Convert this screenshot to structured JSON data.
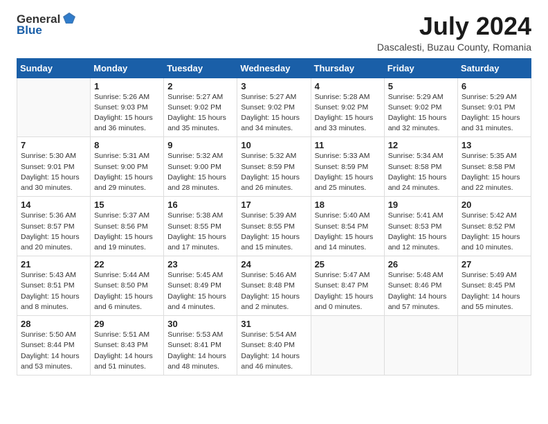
{
  "logo": {
    "general": "General",
    "blue": "Blue"
  },
  "title": "July 2024",
  "subtitle": "Dascalesti, Buzau County, Romania",
  "weekdays": [
    "Sunday",
    "Monday",
    "Tuesday",
    "Wednesday",
    "Thursday",
    "Friday",
    "Saturday"
  ],
  "weeks": [
    [
      {
        "day": "",
        "sunrise": "",
        "sunset": "",
        "daylight": ""
      },
      {
        "day": "1",
        "sunrise": "Sunrise: 5:26 AM",
        "sunset": "Sunset: 9:03 PM",
        "daylight": "Daylight: 15 hours and 36 minutes."
      },
      {
        "day": "2",
        "sunrise": "Sunrise: 5:27 AM",
        "sunset": "Sunset: 9:02 PM",
        "daylight": "Daylight: 15 hours and 35 minutes."
      },
      {
        "day": "3",
        "sunrise": "Sunrise: 5:27 AM",
        "sunset": "Sunset: 9:02 PM",
        "daylight": "Daylight: 15 hours and 34 minutes."
      },
      {
        "day": "4",
        "sunrise": "Sunrise: 5:28 AM",
        "sunset": "Sunset: 9:02 PM",
        "daylight": "Daylight: 15 hours and 33 minutes."
      },
      {
        "day": "5",
        "sunrise": "Sunrise: 5:29 AM",
        "sunset": "Sunset: 9:02 PM",
        "daylight": "Daylight: 15 hours and 32 minutes."
      },
      {
        "day": "6",
        "sunrise": "Sunrise: 5:29 AM",
        "sunset": "Sunset: 9:01 PM",
        "daylight": "Daylight: 15 hours and 31 minutes."
      }
    ],
    [
      {
        "day": "7",
        "sunrise": "Sunrise: 5:30 AM",
        "sunset": "Sunset: 9:01 PM",
        "daylight": "Daylight: 15 hours and 30 minutes."
      },
      {
        "day": "8",
        "sunrise": "Sunrise: 5:31 AM",
        "sunset": "Sunset: 9:00 PM",
        "daylight": "Daylight: 15 hours and 29 minutes."
      },
      {
        "day": "9",
        "sunrise": "Sunrise: 5:32 AM",
        "sunset": "Sunset: 9:00 PM",
        "daylight": "Daylight: 15 hours and 28 minutes."
      },
      {
        "day": "10",
        "sunrise": "Sunrise: 5:32 AM",
        "sunset": "Sunset: 8:59 PM",
        "daylight": "Daylight: 15 hours and 26 minutes."
      },
      {
        "day": "11",
        "sunrise": "Sunrise: 5:33 AM",
        "sunset": "Sunset: 8:59 PM",
        "daylight": "Daylight: 15 hours and 25 minutes."
      },
      {
        "day": "12",
        "sunrise": "Sunrise: 5:34 AM",
        "sunset": "Sunset: 8:58 PM",
        "daylight": "Daylight: 15 hours and 24 minutes."
      },
      {
        "day": "13",
        "sunrise": "Sunrise: 5:35 AM",
        "sunset": "Sunset: 8:58 PM",
        "daylight": "Daylight: 15 hours and 22 minutes."
      }
    ],
    [
      {
        "day": "14",
        "sunrise": "Sunrise: 5:36 AM",
        "sunset": "Sunset: 8:57 PM",
        "daylight": "Daylight: 15 hours and 20 minutes."
      },
      {
        "day": "15",
        "sunrise": "Sunrise: 5:37 AM",
        "sunset": "Sunset: 8:56 PM",
        "daylight": "Daylight: 15 hours and 19 minutes."
      },
      {
        "day": "16",
        "sunrise": "Sunrise: 5:38 AM",
        "sunset": "Sunset: 8:55 PM",
        "daylight": "Daylight: 15 hours and 17 minutes."
      },
      {
        "day": "17",
        "sunrise": "Sunrise: 5:39 AM",
        "sunset": "Sunset: 8:55 PM",
        "daylight": "Daylight: 15 hours and 15 minutes."
      },
      {
        "day": "18",
        "sunrise": "Sunrise: 5:40 AM",
        "sunset": "Sunset: 8:54 PM",
        "daylight": "Daylight: 15 hours and 14 minutes."
      },
      {
        "day": "19",
        "sunrise": "Sunrise: 5:41 AM",
        "sunset": "Sunset: 8:53 PM",
        "daylight": "Daylight: 15 hours and 12 minutes."
      },
      {
        "day": "20",
        "sunrise": "Sunrise: 5:42 AM",
        "sunset": "Sunset: 8:52 PM",
        "daylight": "Daylight: 15 hours and 10 minutes."
      }
    ],
    [
      {
        "day": "21",
        "sunrise": "Sunrise: 5:43 AM",
        "sunset": "Sunset: 8:51 PM",
        "daylight": "Daylight: 15 hours and 8 minutes."
      },
      {
        "day": "22",
        "sunrise": "Sunrise: 5:44 AM",
        "sunset": "Sunset: 8:50 PM",
        "daylight": "Daylight: 15 hours and 6 minutes."
      },
      {
        "day": "23",
        "sunrise": "Sunrise: 5:45 AM",
        "sunset": "Sunset: 8:49 PM",
        "daylight": "Daylight: 15 hours and 4 minutes."
      },
      {
        "day": "24",
        "sunrise": "Sunrise: 5:46 AM",
        "sunset": "Sunset: 8:48 PM",
        "daylight": "Daylight: 15 hours and 2 minutes."
      },
      {
        "day": "25",
        "sunrise": "Sunrise: 5:47 AM",
        "sunset": "Sunset: 8:47 PM",
        "daylight": "Daylight: 15 hours and 0 minutes."
      },
      {
        "day": "26",
        "sunrise": "Sunrise: 5:48 AM",
        "sunset": "Sunset: 8:46 PM",
        "daylight": "Daylight: 14 hours and 57 minutes."
      },
      {
        "day": "27",
        "sunrise": "Sunrise: 5:49 AM",
        "sunset": "Sunset: 8:45 PM",
        "daylight": "Daylight: 14 hours and 55 minutes."
      }
    ],
    [
      {
        "day": "28",
        "sunrise": "Sunrise: 5:50 AM",
        "sunset": "Sunset: 8:44 PM",
        "daylight": "Daylight: 14 hours and 53 minutes."
      },
      {
        "day": "29",
        "sunrise": "Sunrise: 5:51 AM",
        "sunset": "Sunset: 8:43 PM",
        "daylight": "Daylight: 14 hours and 51 minutes."
      },
      {
        "day": "30",
        "sunrise": "Sunrise: 5:53 AM",
        "sunset": "Sunset: 8:41 PM",
        "daylight": "Daylight: 14 hours and 48 minutes."
      },
      {
        "day": "31",
        "sunrise": "Sunrise: 5:54 AM",
        "sunset": "Sunset: 8:40 PM",
        "daylight": "Daylight: 14 hours and 46 minutes."
      },
      {
        "day": "",
        "sunrise": "",
        "sunset": "",
        "daylight": ""
      },
      {
        "day": "",
        "sunrise": "",
        "sunset": "",
        "daylight": ""
      },
      {
        "day": "",
        "sunrise": "",
        "sunset": "",
        "daylight": ""
      }
    ]
  ]
}
